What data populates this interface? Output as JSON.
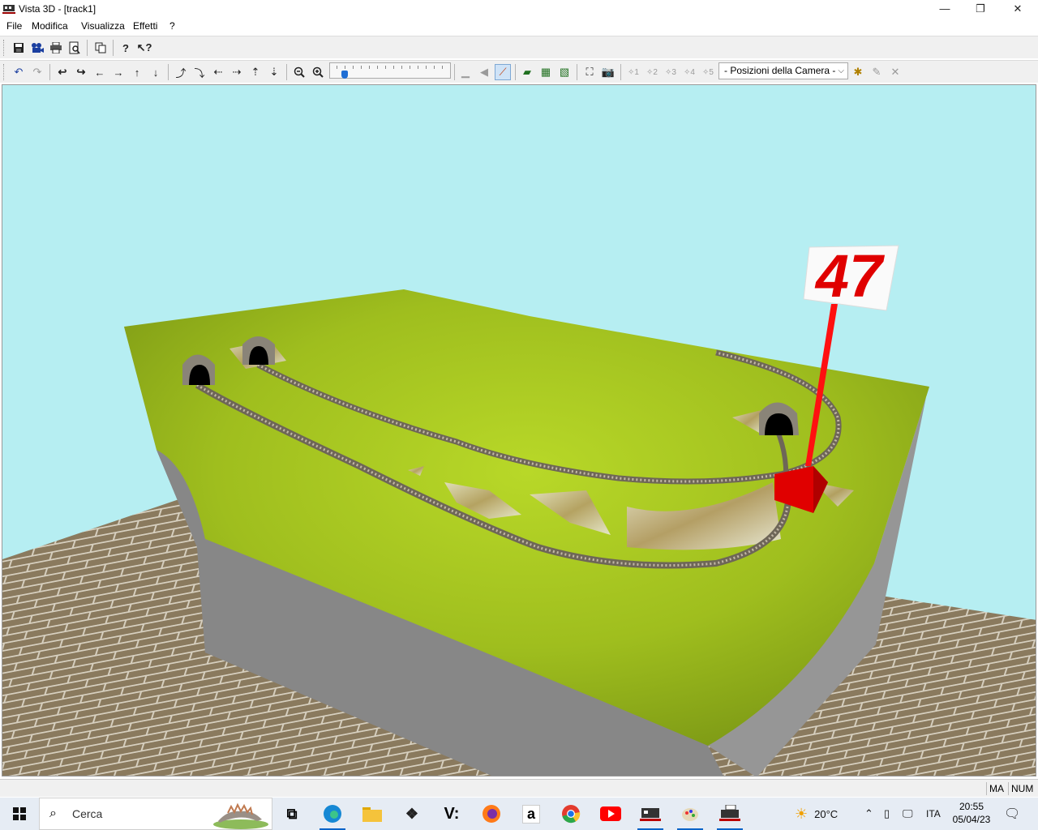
{
  "window": {
    "title": "Vista 3D - [track1]",
    "minimize_glyph": "—",
    "restore_glyph": "❐",
    "close_glyph": "✕"
  },
  "menu": [
    "File",
    "Modifica",
    "Visualizza",
    "Effetti",
    "?"
  ],
  "toolbar2": {
    "camera_select_value": "- Posizioni della Camera -",
    "camera_numbers": [
      "1",
      "2",
      "3",
      "4",
      "5"
    ]
  },
  "viewport": {
    "sign_text": "47",
    "sky_color": "#b6eef2",
    "grass_color": "#a6c81c",
    "base_color": "#8d8d8d",
    "floor_color": "#8a7a5e",
    "marker_color": "#ff1010"
  },
  "statusbar": {
    "caps": "MA",
    "num": "NUM"
  },
  "taskbar": {
    "search_placeholder": "Cerca",
    "weather": "20°C",
    "language": "ITA",
    "time": "20:55",
    "date": "05/04/23",
    "v_label": "V:",
    "amazon_label": "a"
  }
}
